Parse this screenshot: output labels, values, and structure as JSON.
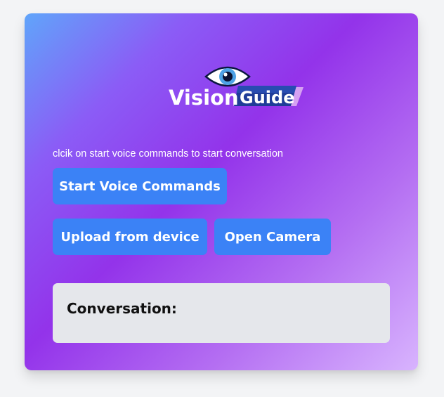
{
  "logo": {
    "word1": "Vision",
    "word2": "Guide",
    "icon": "eye-icon"
  },
  "instruction_text": "clcik on start voice commands to start conversation",
  "buttons": {
    "start_voice": "Start Voice Commands",
    "upload": "Upload from device",
    "camera": "Open Camera"
  },
  "conversation": {
    "title": "Conversation:"
  },
  "colors": {
    "page_background": "#f3f4f6",
    "button": "#3b82f6",
    "panel": "#e5e7eb",
    "gradient": [
      "#60a5fa",
      "#9333ea",
      "#d8b4fe"
    ]
  }
}
